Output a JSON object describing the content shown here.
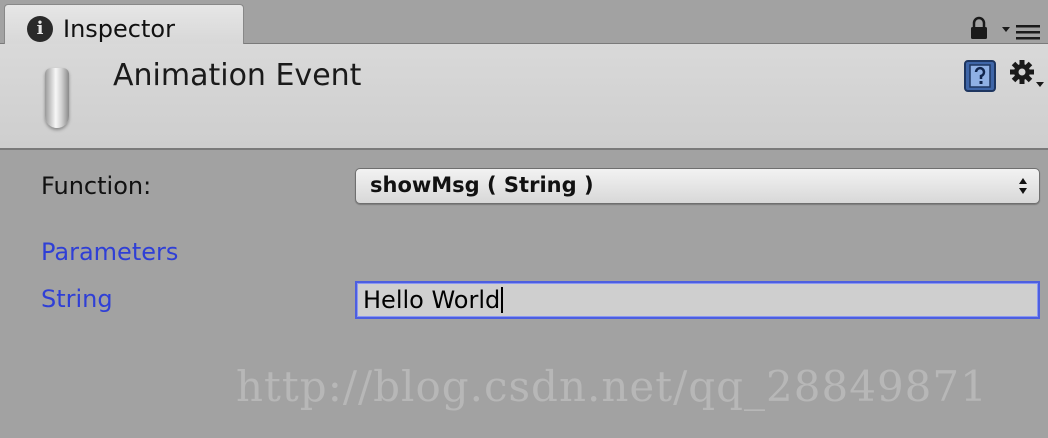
{
  "tab": {
    "label": "Inspector",
    "info_glyph": "i"
  },
  "header": {
    "title": "Animation Event"
  },
  "function_row": {
    "label": "Function:",
    "value": "showMsg ( String )"
  },
  "parameters": {
    "heading": "Parameters",
    "string_label": "String",
    "string_value": "Hello World"
  },
  "watermark": "http://blog.csdn.net/qq_28849871",
  "icons": [
    "info-icon",
    "lock-icon",
    "panel-menu-icon",
    "object-icon",
    "help-book-icon",
    "gear-icon",
    "dropdown-arrows-icon"
  ],
  "colors": {
    "link_blue": "#2f3fd6",
    "focus_border": "#4d5fe0",
    "panel_bg": "#a2a2a2"
  }
}
